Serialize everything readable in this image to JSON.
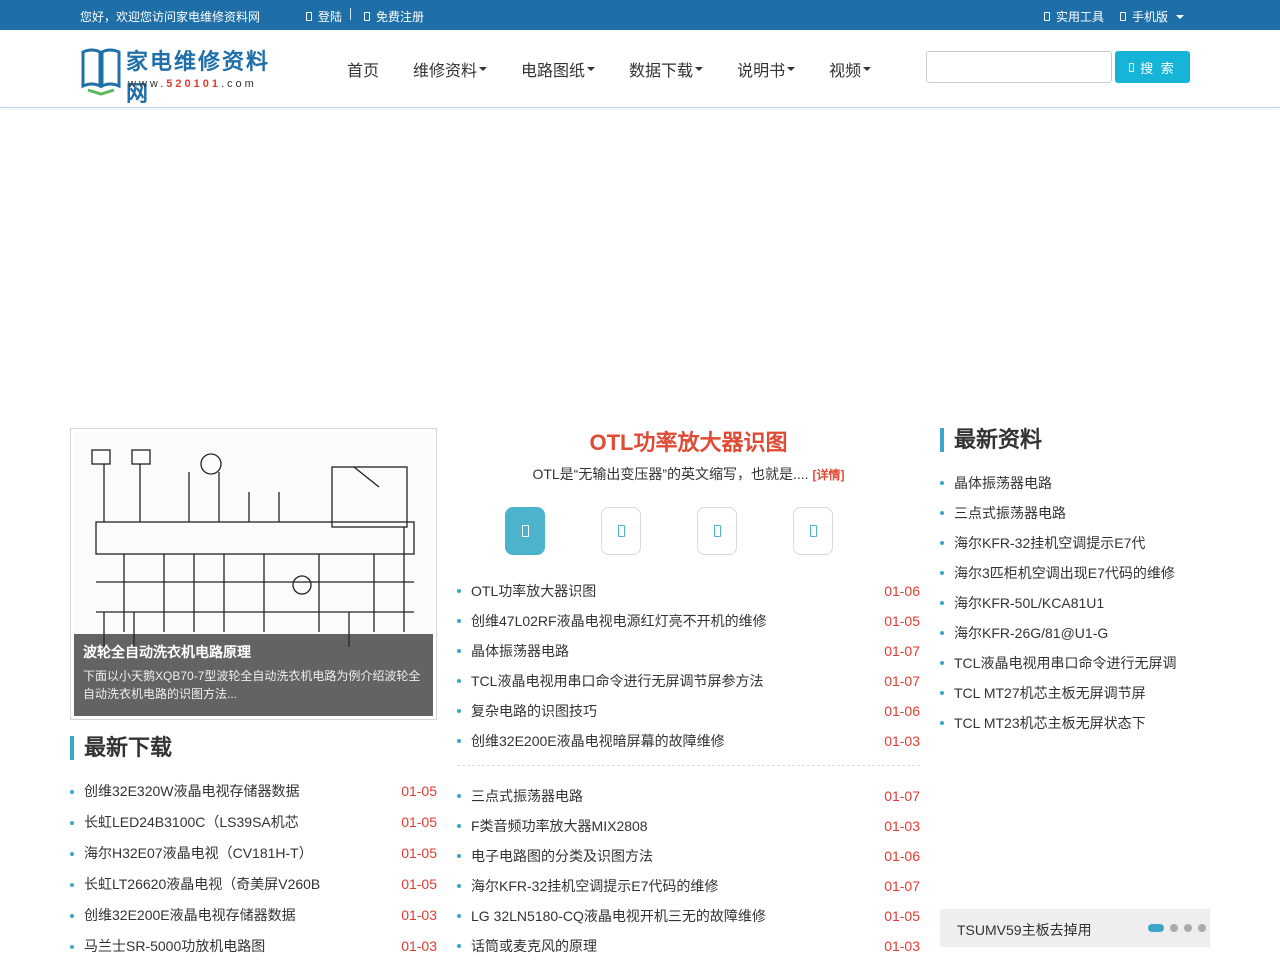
{
  "topbar": {
    "welcome": "您好，欢迎您访问家电维修资料网",
    "login": "登陆",
    "register": "免费注册",
    "tools": "实用工具",
    "mobile": "手机版"
  },
  "logo": {
    "brand": "家电维修资料网",
    "url_prefix": "www.",
    "url_num": "520101",
    "url_suffix": ".com"
  },
  "nav": [
    {
      "label": "首页",
      "dropdown": false
    },
    {
      "label": "维修资料",
      "dropdown": true
    },
    {
      "label": "电路图纸",
      "dropdown": true
    },
    {
      "label": "数据下载",
      "dropdown": true
    },
    {
      "label": "说明书",
      "dropdown": true
    },
    {
      "label": "视频",
      "dropdown": true
    }
  ],
  "search": {
    "placeholder": "",
    "button": "搜 索"
  },
  "featured": {
    "title": "波轮全自动洗衣机电路原理",
    "desc": "下面以小天鹅XQB70-7型波轮全自动洗衣机电路为例介绍波轮全自动洗衣机电路的识图方法..."
  },
  "downloads": {
    "heading": "最新下载",
    "items": [
      {
        "title": "创维32E320W液晶电视存储器数据",
        "date": "01-05"
      },
      {
        "title": "长虹LED24B3100C（LS39SA机芯",
        "date": "01-05"
      },
      {
        "title": "海尔H32E07液晶电视（CV181H-T）",
        "date": "01-05"
      },
      {
        "title": "长虹LT26620液晶电视（奇美屏V260B",
        "date": "01-05"
      },
      {
        "title": "创维32E200E液晶电视存储器数据",
        "date": "01-03"
      },
      {
        "title": "马兰士SR-5000功放机电路图",
        "date": "01-03"
      }
    ]
  },
  "center": {
    "headline": "OTL功率放大器识图",
    "summary": "OTL是“无输出变压器”的英文缩写，也就是....",
    "more": "[详情]",
    "tab_icons": [
      "tab-icon-1",
      "tab-icon-2",
      "tab-icon-3",
      "tab-icon-4"
    ],
    "list1": [
      {
        "title": "OTL功率放大器识图",
        "date": "01-06"
      },
      {
        "title": "创维47L02RF液晶电视电源红灯亮不开机的维修",
        "date": "01-05"
      },
      {
        "title": "晶体振荡器电路",
        "date": "01-07"
      },
      {
        "title": "TCL液晶电视用串口命令进行无屏调节屏参方法",
        "date": "01-07"
      },
      {
        "title": "复杂电路的识图技巧",
        "date": "01-06"
      },
      {
        "title": "创维32E200E液晶电视暗屏幕的故障维修",
        "date": "01-03"
      }
    ],
    "list2": [
      {
        "title": "三点式振荡器电路",
        "date": "01-07"
      },
      {
        "title": "F类音频功率放大器MIX2808",
        "date": "01-03"
      },
      {
        "title": "电子电路图的分类及识图方法",
        "date": "01-06"
      },
      {
        "title": "海尔KFR-32挂机空调提示E7代码的维修",
        "date": "01-07"
      },
      {
        "title": "LG 32LN5180-CQ液晶电视开机三无的故障维修",
        "date": "01-05"
      },
      {
        "title": "话筒或麦克风的原理",
        "date": "01-03"
      }
    ]
  },
  "latest": {
    "heading": "最新资料",
    "items": [
      "晶体振荡器电路",
      "三点式振荡器电路",
      "海尔KFR-32挂机空调提示E7代",
      "海尔3匹柜机空调出现E7代码的维修",
      "海尔KFR-50L/KCA81U1",
      "海尔KFR-26G/81@U1-G",
      "TCL液晶电视用串口命令进行无屏调",
      "TCL MT27机芯主板无屏调节屏",
      "TCL MT23机芯主板无屏状态下"
    ]
  },
  "slider": {
    "title": "TSUMV59主板去掉用",
    "active_index": 0,
    "count": 4
  },
  "colors": {
    "topbar": "#1e6fa8",
    "accent": "#3aa7c9",
    "search_button": "#16b5d8",
    "date_red": "#e23b2f"
  }
}
